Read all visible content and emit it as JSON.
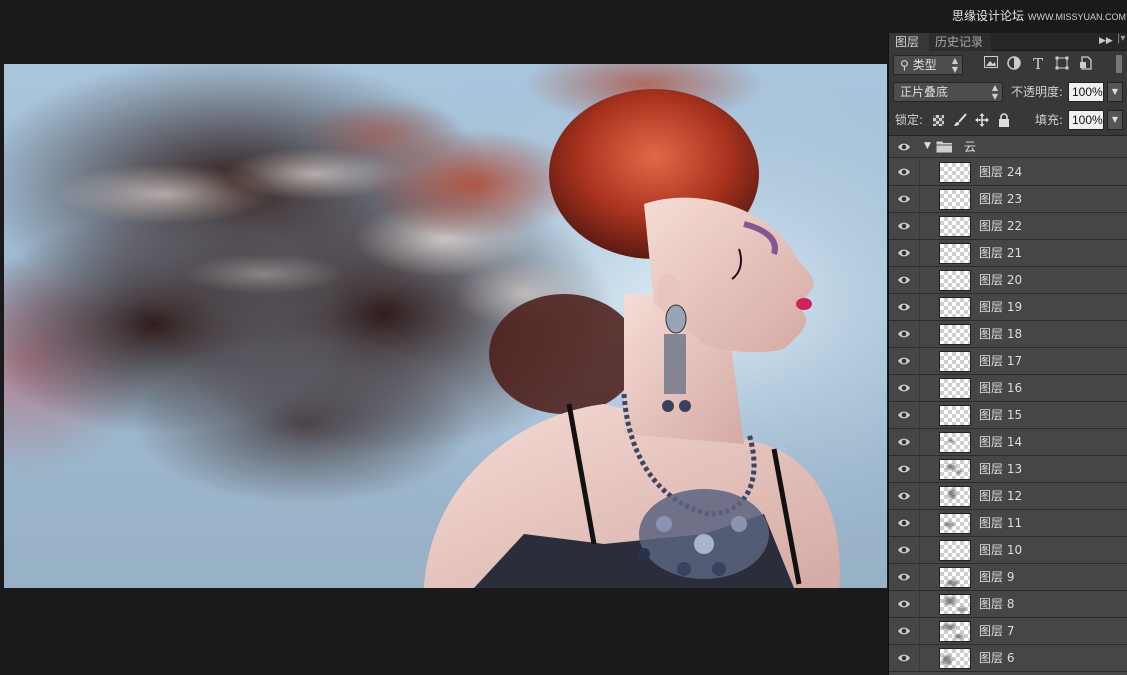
{
  "watermark": {
    "cn": "思缘设计论坛",
    "url": "WWW.MISSYUAN.COM"
  },
  "panel": {
    "tabs": [
      "图层",
      "历史记录"
    ],
    "filter": {
      "kind_label": "类型"
    },
    "blend_mode": "正片叠底",
    "opacity_label": "不透明度:",
    "opacity_value": "100%",
    "lock_label": "锁定:",
    "fill_label": "填充:",
    "fill_value": "100%",
    "group": {
      "name": "云",
      "expanded": true,
      "visible": true
    },
    "layers": [
      "图层 24",
      "图层 23",
      "图层 22",
      "图层 21",
      "图层 20",
      "图层 19",
      "图层 18",
      "图层 17",
      "图层 16",
      "图层 15",
      "图层 14",
      "图层 13",
      "图层 12",
      "图层 11",
      "图层 10",
      "图层 9",
      "图层 8",
      "图层 7",
      "图层 6"
    ]
  },
  "icons": [
    "search-icon",
    "image-filter-icon",
    "adjustment-filter-icon",
    "type-filter-icon",
    "shape-filter-icon",
    "smart-object-filter-icon",
    "lock-pixels-icon",
    "lock-paint-icon",
    "lock-position-icon",
    "lock-all-icon",
    "eye-icon",
    "folder-icon"
  ],
  "colors": {
    "app_bg": "#1a1a1a",
    "panel_bg": "#383838",
    "layer_row_bg": "#464646",
    "canvas_sky": "#a9c6dd",
    "hair": "#c2442a"
  }
}
